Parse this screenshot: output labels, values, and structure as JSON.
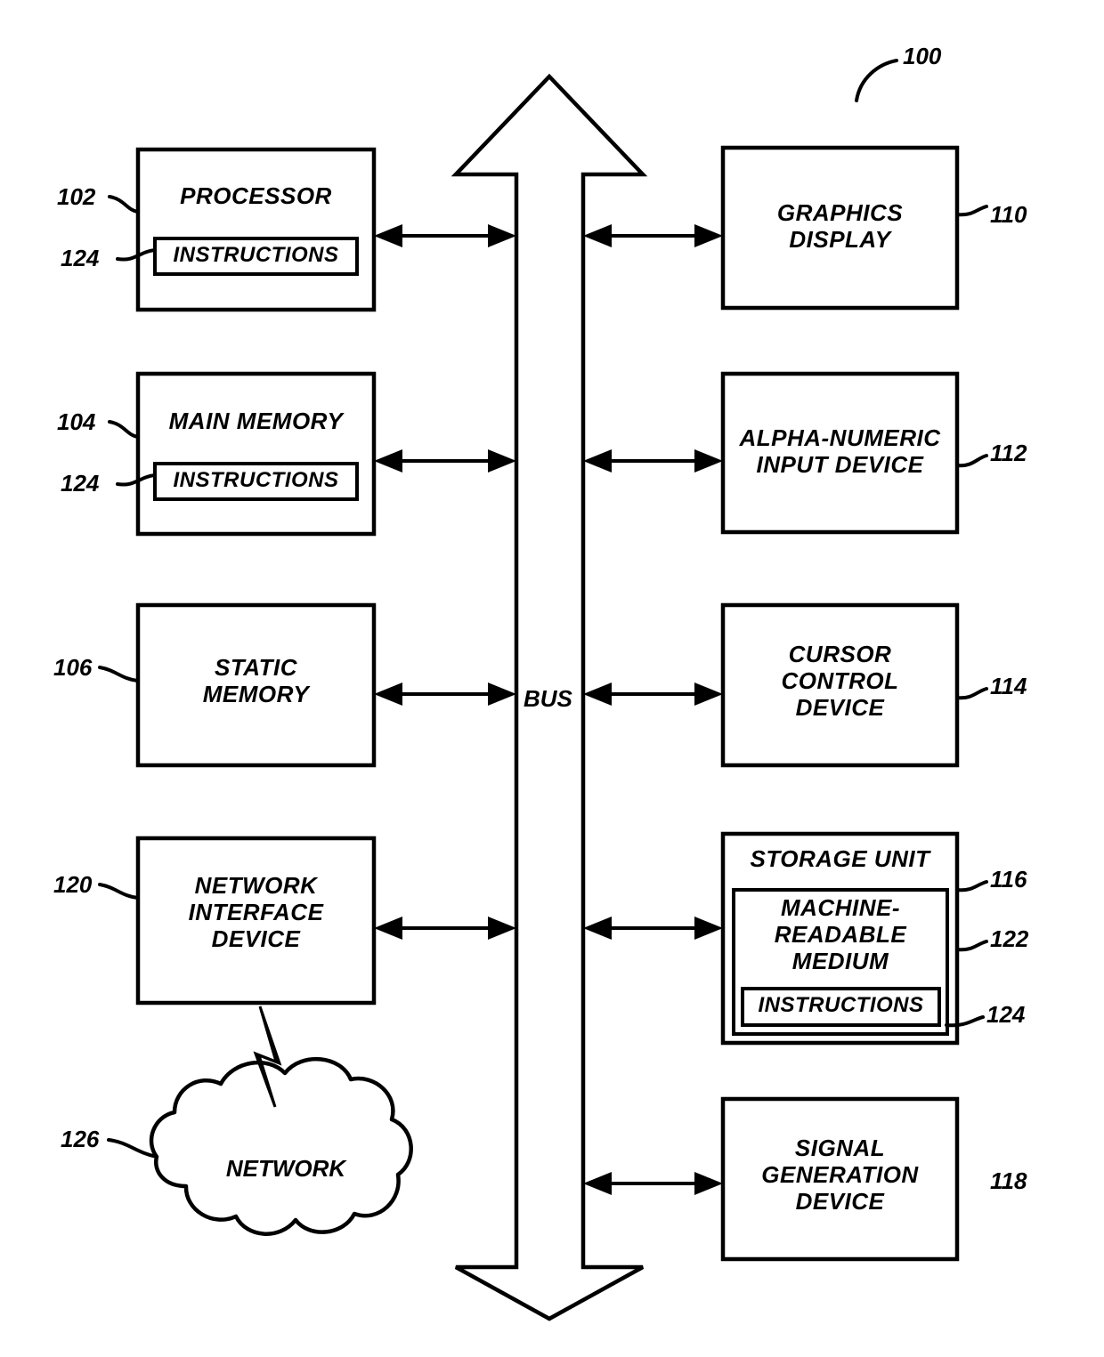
{
  "figure": {
    "ref_number": "100",
    "bus_label": "BUS"
  },
  "left_column": [
    {
      "ref": "102",
      "title": "PROCESSOR",
      "inner": {
        "ref": "124",
        "label": "INSTRUCTIONS"
      }
    },
    {
      "ref": "104",
      "title": "MAIN MEMORY",
      "inner": {
        "ref": "124",
        "label": "INSTRUCTIONS"
      }
    },
    {
      "ref": "106",
      "title": "STATIC\nMEMORY",
      "inner": null
    },
    {
      "ref": "120",
      "title": "NETWORK\nINTERFACE\nDEVICE",
      "inner": null
    }
  ],
  "right_column": [
    {
      "ref": "110",
      "title": "GRAPHICS\nDISPLAY"
    },
    {
      "ref": "112",
      "title": "ALPHA-NUMERIC\nINPUT DEVICE"
    },
    {
      "ref": "114",
      "title": "CURSOR\nCONTROL\nDEVICE"
    },
    {
      "ref": "116",
      "title": "STORAGE UNIT",
      "medium": {
        "ref": "122",
        "label": "MACHINE-\nREADABLE\nMEDIUM"
      },
      "instructions": {
        "ref": "124",
        "label": "INSTRUCTIONS"
      }
    },
    {
      "ref": "118",
      "title": "SIGNAL\nGENERATION\nDEVICE"
    }
  ],
  "network": {
    "ref": "126",
    "label": "NETWORK"
  },
  "colors": {
    "stroke": "#000000",
    "fill": "#ffffff"
  }
}
